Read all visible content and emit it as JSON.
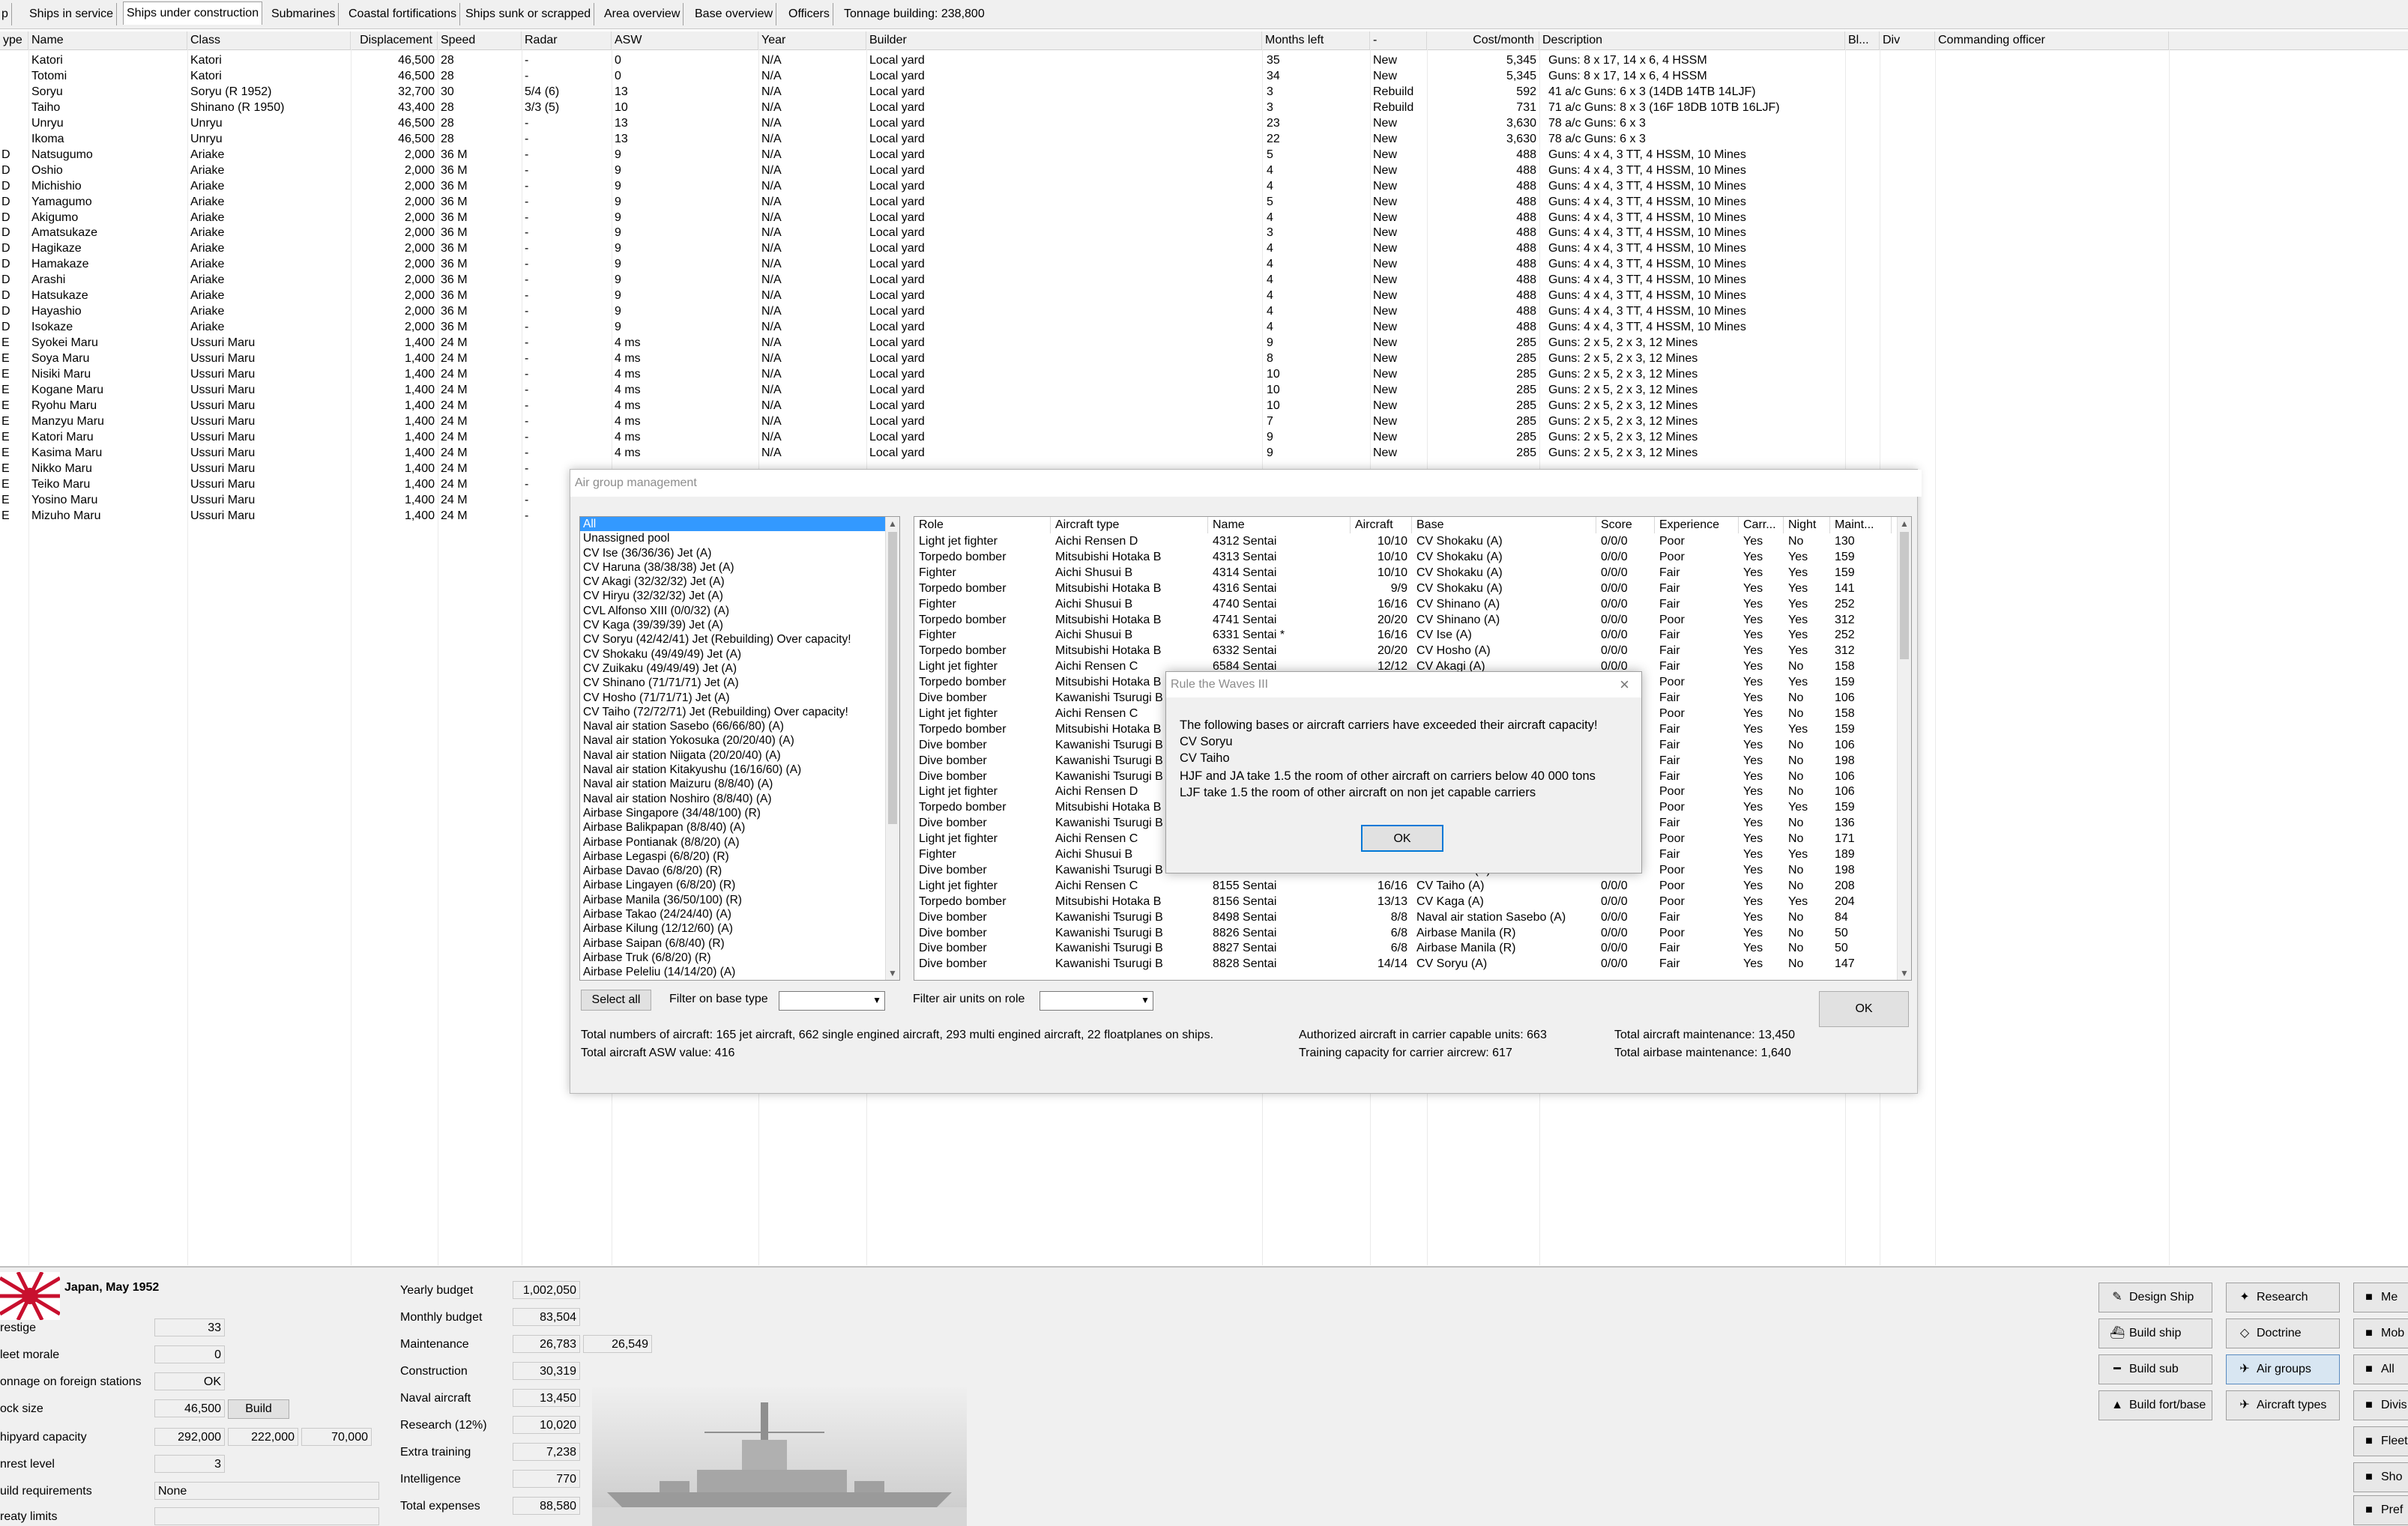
{
  "tabs": [
    "p",
    "Ships in service",
    "Ships under construction",
    "Submarines",
    "Coastal fortifications",
    "Ships sunk or scrapped",
    "Area overview",
    "Base overview",
    "Officers"
  ],
  "tonnage_building": "Tonnage building: 238,800",
  "main_table": {
    "headers": [
      "ype",
      "Name",
      "Class",
      "Displacement",
      "Speed",
      "Radar",
      "ASW",
      "Year",
      "Builder",
      "Months left",
      "-",
      "Cost/month",
      "Description",
      "Bl...",
      "Div",
      "Commanding officer"
    ],
    "rows": [
      [
        "",
        "Katori",
        "Katori",
        "46,500",
        "28",
        "-",
        "0",
        "N/A",
        "Local yard",
        "35",
        "New",
        "5,345",
        "Guns: 8 x 17, 14 x 6, 4 HSSM"
      ],
      [
        "",
        "Totomi",
        "Katori",
        "46,500",
        "28",
        "-",
        "0",
        "N/A",
        "Local yard",
        "34",
        "New",
        "5,345",
        "Guns: 8 x 17, 14 x 6, 4 HSSM"
      ],
      [
        "",
        "Soryu",
        "Soryu (R 1952)",
        "32,700",
        "30",
        "5/4 (6)",
        "13",
        "N/A",
        "Local yard",
        "3",
        "Rebuild",
        "592",
        "41 a/c Guns: 6 x 3 (14DB 14TB 14LJF)"
      ],
      [
        "",
        "Taiho",
        "Shinano (R 1950)",
        "43,400",
        "28",
        "3/3 (5)",
        "10",
        "N/A",
        "Local yard",
        "3",
        "Rebuild",
        "731",
        "71 a/c Guns: 8 x 3 (16F 18DB 10TB 16LJF)"
      ],
      [
        "",
        "Unryu",
        "Unryu",
        "46,500",
        "28",
        "-",
        "13",
        "N/A",
        "Local yard",
        "23",
        "New",
        "3,630",
        "78 a/c Guns: 6 x 3"
      ],
      [
        "",
        "Ikoma",
        "Unryu",
        "46,500",
        "28",
        "-",
        "13",
        "N/A",
        "Local yard",
        "22",
        "New",
        "3,630",
        "78 a/c Guns: 6 x 3"
      ],
      [
        "D",
        "Natsugumo",
        "Ariake",
        "2,000",
        "36 M",
        "-",
        "9",
        "N/A",
        "Local yard",
        "5",
        "New",
        "488",
        "Guns: 4 x 4, 3 TT, 4 HSSM, 10 Mines"
      ],
      [
        "D",
        "Oshio",
        "Ariake",
        "2,000",
        "36 M",
        "-",
        "9",
        "N/A",
        "Local yard",
        "4",
        "New",
        "488",
        "Guns: 4 x 4, 3 TT, 4 HSSM, 10 Mines"
      ],
      [
        "D",
        "Michishio",
        "Ariake",
        "2,000",
        "36 M",
        "-",
        "9",
        "N/A",
        "Local yard",
        "4",
        "New",
        "488",
        "Guns: 4 x 4, 3 TT, 4 HSSM, 10 Mines"
      ],
      [
        "D",
        "Yamagumo",
        "Ariake",
        "2,000",
        "36 M",
        "-",
        "9",
        "N/A",
        "Local yard",
        "5",
        "New",
        "488",
        "Guns: 4 x 4, 3 TT, 4 HSSM, 10 Mines"
      ],
      [
        "D",
        "Akigumo",
        "Ariake",
        "2,000",
        "36 M",
        "-",
        "9",
        "N/A",
        "Local yard",
        "4",
        "New",
        "488",
        "Guns: 4 x 4, 3 TT, 4 HSSM, 10 Mines"
      ],
      [
        "D",
        "Amatsukaze",
        "Ariake",
        "2,000",
        "36 M",
        "-",
        "9",
        "N/A",
        "Local yard",
        "3",
        "New",
        "488",
        "Guns: 4 x 4, 3 TT, 4 HSSM, 10 Mines"
      ],
      [
        "D",
        "Hagikaze",
        "Ariake",
        "2,000",
        "36 M",
        "-",
        "9",
        "N/A",
        "Local yard",
        "4",
        "New",
        "488",
        "Guns: 4 x 4, 3 TT, 4 HSSM, 10 Mines"
      ],
      [
        "D",
        "Hamakaze",
        "Ariake",
        "2,000",
        "36 M",
        "-",
        "9",
        "N/A",
        "Local yard",
        "4",
        "New",
        "488",
        "Guns: 4 x 4, 3 TT, 4 HSSM, 10 Mines"
      ],
      [
        "D",
        "Arashi",
        "Ariake",
        "2,000",
        "36 M",
        "-",
        "9",
        "N/A",
        "Local yard",
        "4",
        "New",
        "488",
        "Guns: 4 x 4, 3 TT, 4 HSSM, 10 Mines"
      ],
      [
        "D",
        "Hatsukaze",
        "Ariake",
        "2,000",
        "36 M",
        "-",
        "9",
        "N/A",
        "Local yard",
        "4",
        "New",
        "488",
        "Guns: 4 x 4, 3 TT, 4 HSSM, 10 Mines"
      ],
      [
        "D",
        "Hayashio",
        "Ariake",
        "2,000",
        "36 M",
        "-",
        "9",
        "N/A",
        "Local yard",
        "4",
        "New",
        "488",
        "Guns: 4 x 4, 3 TT, 4 HSSM, 10 Mines"
      ],
      [
        "D",
        "Isokaze",
        "Ariake",
        "2,000",
        "36 M",
        "-",
        "9",
        "N/A",
        "Local yard",
        "4",
        "New",
        "488",
        "Guns: 4 x 4, 3 TT, 4 HSSM, 10 Mines"
      ],
      [
        "E",
        "Syokei Maru",
        "Ussuri Maru",
        "1,400",
        "24 M",
        "-",
        "4 ms",
        "N/A",
        "Local yard",
        "9",
        "New",
        "285",
        "Guns: 2 x 5, 2 x 3, 12 Mines"
      ],
      [
        "E",
        "Soya Maru",
        "Ussuri Maru",
        "1,400",
        "24 M",
        "-",
        "4 ms",
        "N/A",
        "Local yard",
        "8",
        "New",
        "285",
        "Guns: 2 x 5, 2 x 3, 12 Mines"
      ],
      [
        "E",
        "Nisiki Maru",
        "Ussuri Maru",
        "1,400",
        "24 M",
        "-",
        "4 ms",
        "N/A",
        "Local yard",
        "10",
        "New",
        "285",
        "Guns: 2 x 5, 2 x 3, 12 Mines"
      ],
      [
        "E",
        "Kogane Maru",
        "Ussuri Maru",
        "1,400",
        "24 M",
        "-",
        "4 ms",
        "N/A",
        "Local yard",
        "10",
        "New",
        "285",
        "Guns: 2 x 5, 2 x 3, 12 Mines"
      ],
      [
        "E",
        "Ryohu Maru",
        "Ussuri Maru",
        "1,400",
        "24 M",
        "-",
        "4 ms",
        "N/A",
        "Local yard",
        "10",
        "New",
        "285",
        "Guns: 2 x 5, 2 x 3, 12 Mines"
      ],
      [
        "E",
        "Manzyu Maru",
        "Ussuri Maru",
        "1,400",
        "24 M",
        "-",
        "4 ms",
        "N/A",
        "Local yard",
        "7",
        "New",
        "285",
        "Guns: 2 x 5, 2 x 3, 12 Mines"
      ],
      [
        "E",
        "Katori Maru",
        "Ussuri Maru",
        "1,400",
        "24 M",
        "-",
        "4 ms",
        "N/A",
        "Local yard",
        "9",
        "New",
        "285",
        "Guns: 2 x 5, 2 x 3, 12 Mines"
      ],
      [
        "E",
        "Kasima Maru",
        "Ussuri Maru",
        "1,400",
        "24 M",
        "-",
        "4 ms",
        "N/A",
        "Local yard",
        "9",
        "New",
        "285",
        "Guns: 2 x 5, 2 x 3, 12 Mines"
      ],
      [
        "E",
        "Nikko Maru",
        "Ussuri Maru",
        "1,400",
        "24 M",
        "-",
        "",
        "",
        "",
        "",
        "",
        "",
        ""
      ],
      [
        "E",
        "Teiko Maru",
        "Ussuri Maru",
        "1,400",
        "24 M",
        "-",
        "",
        "",
        "",
        "",
        "",
        "",
        ""
      ],
      [
        "E",
        "Yosino Maru",
        "Ussuri Maru",
        "1,400",
        "24 M",
        "-",
        "",
        "",
        "",
        "",
        "",
        "",
        ""
      ],
      [
        "E",
        "Mizuho Maru",
        "Ussuri Maru",
        "1,400",
        "24 M",
        "-",
        "",
        "",
        "",
        "",
        "",
        "",
        ""
      ]
    ]
  },
  "air_dialog": {
    "title": "Air group management",
    "groups": [
      "All",
      "Unassigned pool",
      "CV Ise (36/36/36) Jet (A)",
      "CV Haruna (38/38/38) Jet (A)",
      "CV Akagi (32/32/32) Jet (A)",
      "CV Hiryu (32/32/32) Jet (A)",
      "CVL Alfonso XIII (0/0/32) (A)",
      "CV Kaga (39/39/39) Jet (A)",
      "CV Soryu (42/42/41) Jet (Rebuilding) Over capacity!",
      "CV Shokaku (49/49/49) Jet (A)",
      "CV Zuikaku (49/49/49) Jet (A)",
      "CV Shinano (71/71/71) Jet (A)",
      "CV Hosho (71/71/71) Jet (A)",
      "CV Taiho (72/72/71) Jet (Rebuilding) Over capacity!",
      "Naval air station Sasebo (66/66/80) (A)",
      "Naval air station Yokosuka (20/20/40) (A)",
      "Naval air station Niigata (20/20/40) (A)",
      "Naval air station Kitakyushu (16/16/60) (A)",
      "Naval air station Maizuru (8/8/40) (A)",
      "Naval air station Noshiro (8/8/40) (A)",
      "Airbase Singapore (34/48/100) (R)",
      "Airbase Balikpapan (8/8/40) (A)",
      "Airbase Pontianak (8/8/20) (A)",
      "Airbase Legaspi (6/8/20) (R)",
      "Airbase Davao (6/8/20) (R)",
      "Airbase Lingayen (6/8/20) (R)",
      "Airbase Manila (36/50/100) (R)",
      "Airbase Takao (24/24/40) (A)",
      "Airbase Kilung (12/12/60) (A)",
      "Airbase Saipan (6/8/40) (R)",
      "Airbase Truk (6/8/20) (R)",
      "Airbase Peleliu (14/14/20) (A)"
    ],
    "columns": [
      "Role",
      "Aircraft type",
      "Name",
      "Aircraft",
      "Base",
      "Score",
      "Experience",
      "Carr...",
      "Night",
      "Maint..."
    ],
    "rows": [
      [
        "Light jet fighter",
        "Aichi Rensen D",
        "4312 Sentai",
        "10/10",
        "CV Shokaku (A)",
        "0/0/0",
        "Poor",
        "Yes",
        "No",
        "130"
      ],
      [
        "Torpedo bomber",
        "Mitsubishi Hotaka B",
        "4313 Sentai",
        "10/10",
        "CV Shokaku (A)",
        "0/0/0",
        "Poor",
        "Yes",
        "Yes",
        "159"
      ],
      [
        "Fighter",
        "Aichi Shusui B",
        "4314 Sentai",
        "10/10",
        "CV Shokaku (A)",
        "0/0/0",
        "Fair",
        "Yes",
        "Yes",
        "159"
      ],
      [
        "Torpedo bomber",
        "Mitsubishi Hotaka B",
        "4316 Sentai",
        "9/9",
        "CV Shokaku (A)",
        "0/0/0",
        "Fair",
        "Yes",
        "Yes",
        "141"
      ],
      [
        "Fighter",
        "Aichi Shusui B",
        "4740 Sentai",
        "16/16",
        "CV Shinano (A)",
        "0/0/0",
        "Fair",
        "Yes",
        "Yes",
        "252"
      ],
      [
        "Torpedo bomber",
        "Mitsubishi Hotaka B",
        "4741 Sentai",
        "20/20",
        "CV Shinano (A)",
        "0/0/0",
        "Poor",
        "Yes",
        "Yes",
        "312"
      ],
      [
        "Fighter",
        "Aichi Shusui B",
        "6331 Sentai *",
        "16/16",
        "CV Ise (A)",
        "0/0/0",
        "Fair",
        "Yes",
        "Yes",
        "252"
      ],
      [
        "Torpedo bomber",
        "Mitsubishi Hotaka B",
        "6332 Sentai",
        "20/20",
        "CV Hosho (A)",
        "0/0/0",
        "Fair",
        "Yes",
        "Yes",
        "312"
      ],
      [
        "Light jet fighter",
        "Aichi Rensen C",
        "6584 Sentai",
        "12/12",
        "CV Akagi (A)",
        "0/0/0",
        "Fair",
        "Yes",
        "No",
        "158"
      ],
      [
        "Torpedo bomber",
        "Mitsubishi Hotaka B",
        "",
        "",
        "",
        "",
        "Poor",
        "Yes",
        "Yes",
        "159"
      ],
      [
        "Dive bomber",
        "Kawanishi Tsurugi B",
        "",
        "",
        "",
        "",
        "Fair",
        "Yes",
        "No",
        "106"
      ],
      [
        "Light jet fighter",
        "Aichi Rensen C",
        "",
        "",
        "",
        "",
        "Poor",
        "Yes",
        "No",
        "158"
      ],
      [
        "Torpedo bomber",
        "Mitsubishi Hotaka B",
        "",
        "",
        "",
        "",
        "Fair",
        "Yes",
        "Yes",
        "159"
      ],
      [
        "Dive bomber",
        "Kawanishi Tsurugi B",
        "",
        "",
        "",
        "",
        "Fair",
        "Yes",
        "No",
        "106"
      ],
      [
        "Dive bomber",
        "Kawanishi Tsurugi B",
        "",
        "",
        "",
        "",
        "Fair",
        "Yes",
        "No",
        "198"
      ],
      [
        "Dive bomber",
        "Kawanishi Tsurugi B",
        "",
        "",
        "",
        "",
        "Fair",
        "Yes",
        "No",
        "106"
      ],
      [
        "Light jet fighter",
        "Aichi Rensen D",
        "",
        "",
        "",
        "",
        "Poor",
        "Yes",
        "No",
        "106"
      ],
      [
        "Torpedo bomber",
        "Mitsubishi Hotaka B",
        "",
        "",
        "",
        "",
        "Poor",
        "Yes",
        "Yes",
        "159"
      ],
      [
        "Dive bomber",
        "Kawanishi Tsurugi B",
        "",
        "",
        "",
        "",
        "Fair",
        "Yes",
        "No",
        "136"
      ],
      [
        "Light jet fighter",
        "Aichi Rensen C",
        "",
        "",
        "",
        "",
        "Poor",
        "Yes",
        "No",
        "171"
      ],
      [
        "Fighter",
        "Aichi Shusui B",
        "",
        "",
        "",
        "",
        "Fair",
        "Yes",
        "Yes",
        "189"
      ],
      [
        "Dive bomber",
        "Kawanishi Tsurugi B",
        "8154 Sentai",
        "19/19",
        "CV Hosho (A)",
        "0/0/0",
        "Poor",
        "Yes",
        "No",
        "198"
      ],
      [
        "Light jet fighter",
        "Aichi Rensen C",
        "8155 Sentai",
        "16/16",
        "CV Taiho (A)",
        "0/0/0",
        "Poor",
        "Yes",
        "No",
        "208"
      ],
      [
        "Torpedo bomber",
        "Mitsubishi Hotaka B",
        "8156 Sentai",
        "13/13",
        "CV Kaga (A)",
        "0/0/0",
        "Poor",
        "Yes",
        "Yes",
        "204"
      ],
      [
        "Dive bomber",
        "Kawanishi Tsurugi B",
        "8498 Sentai",
        "8/8",
        "Naval air station Sasebo (A)",
        "0/0/0",
        "Fair",
        "Yes",
        "No",
        "84"
      ],
      [
        "Dive bomber",
        "Kawanishi Tsurugi B",
        "8826 Sentai",
        "6/8",
        "Airbase Manila (R)",
        "0/0/0",
        "Poor",
        "Yes",
        "No",
        "50"
      ],
      [
        "Dive bomber",
        "Kawanishi Tsurugi B",
        "8827 Sentai",
        "6/8",
        "Airbase Manila (R)",
        "0/0/0",
        "Fair",
        "Yes",
        "No",
        "50"
      ],
      [
        "Dive bomber",
        "Kawanishi Tsurugi B",
        "8828 Sentai",
        "14/14",
        "CV Soryu (A)",
        "0/0/0",
        "Fair",
        "Yes",
        "No",
        "147"
      ]
    ],
    "select_all": "Select all",
    "filter_base_label": "Filter on base type",
    "filter_role_label": "Filter air units on role",
    "ok": "OK",
    "stats": {
      "total_aircraft": "Total numbers of aircraft: 165 jet aircraft, 662 single engined aircraft, 293 multi engined aircraft, 22 floatplanes on ships.",
      "asw_value": "Total aircraft ASW value: 416",
      "authorized": "Authorized aircraft in carrier capable units: 663",
      "training": "Training capacity for carrier aircrew: 617",
      "maintenance": "Total aircraft maintenance: 13,450",
      "airbase_maintenance": "Total airbase maintenance: 1,640"
    }
  },
  "message_box": {
    "title": "Rule the Waves III",
    "lines": [
      "The following bases or aircraft carriers have exceeded their aircraft capacity!",
      "CV Soryu",
      "CV Taiho",
      "HJF and JA take 1.5 the room of other aircraft on carriers below 40 000 tons",
      "LJF take 1.5 the room of other aircraft on non jet capable carriers"
    ],
    "ok": "OK"
  },
  "status_panel": {
    "country": "Japan, May 1952",
    "flag_color": "#c8102e",
    "left": [
      {
        "label": "restige",
        "value": "33"
      },
      {
        "label": "leet morale",
        "value": "0"
      },
      {
        "label": "onnage on foreign stations",
        "value": "OK"
      },
      {
        "label": "ock size",
        "value": "46,500",
        "button": "Build"
      },
      {
        "label": "hipyard capacity",
        "value": "292,000",
        "value2": "222,000",
        "value3": "70,000"
      },
      {
        "label": "nrest level",
        "value": "3"
      },
      {
        "label": "uild requirements",
        "value": "None"
      },
      {
        "label": "reaty limits",
        "value": ""
      }
    ],
    "budget": [
      {
        "label": "Yearly budget",
        "value": "1,002,050"
      },
      {
        "label": "Monthly budget",
        "value": "83,504"
      },
      {
        "label": "Maintenance",
        "value": "26,783",
        "value2": "26,549"
      },
      {
        "label": "Construction",
        "value": "30,319"
      },
      {
        "label": "Naval aircraft",
        "value": "13,450"
      },
      {
        "label": "Research (12%)",
        "value": "10,020"
      },
      {
        "label": "Extra training",
        "value": "7,238"
      },
      {
        "label": "Intelligence",
        "value": "770"
      },
      {
        "label": "Total expenses",
        "value": "88,580"
      }
    ],
    "buttons": [
      {
        "label": "Design Ship",
        "icon": "pencil-ship-icon"
      },
      {
        "label": "Research",
        "icon": "bulb-icon"
      },
      {
        "label": "Build ship",
        "icon": "ship-icon"
      },
      {
        "label": "Doctrine",
        "icon": "diamond-icon"
      },
      {
        "label": "Build sub",
        "icon": "sub-icon"
      },
      {
        "label": "Air groups",
        "icon": "plane-group-icon"
      },
      {
        "label": "Build fort/base",
        "icon": "fort-icon"
      },
      {
        "label": "Aircraft types",
        "icon": "plane-icon"
      }
    ],
    "edge_buttons": [
      "Me",
      "Mob",
      "All",
      "Divis",
      "Fleet",
      "Sho",
      "Pref"
    ]
  }
}
